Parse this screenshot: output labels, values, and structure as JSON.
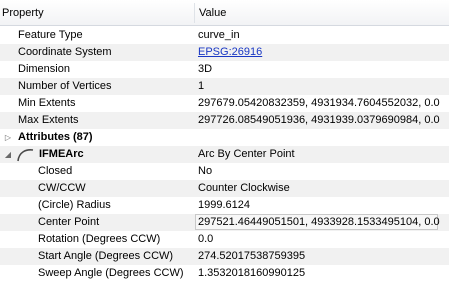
{
  "header": {
    "property_label": "Property",
    "value_label": "Value"
  },
  "rows": [
    {
      "name": "Feature Type",
      "value": "curve_in"
    },
    {
      "name": "Coordinate System",
      "value": "EPSG:26916"
    },
    {
      "name": "Dimension",
      "value": "3D"
    },
    {
      "name": "Number of Vertices",
      "value": "1"
    },
    {
      "name": "Min Extents",
      "value": "297679.05420832359, 4931934.7604552032, 0.0"
    },
    {
      "name": "Max Extents",
      "value": "297726.08549051936, 4931939.0379690984, 0.0"
    }
  ],
  "attributes": {
    "label": "Attributes (87)"
  },
  "arc": {
    "label": "IFMEArc",
    "value": "Arc By Center Point",
    "icon": "arc-icon",
    "children": [
      {
        "name": "Closed",
        "value": "No"
      },
      {
        "name": "CW/CCW",
        "value": "Counter Clockwise"
      },
      {
        "name": "(Circle) Radius",
        "value": "1999.6124"
      },
      {
        "name": "Center Point",
        "value": "297521.46449051501, 4933928.1533495104, 0.0"
      },
      {
        "name": "Rotation (Degrees CCW)",
        "value": "0.0"
      },
      {
        "name": "Start Angle (Degrees CCW)",
        "value": "274.52017538759395"
      },
      {
        "name": "Sweep Angle (Degrees CCW)",
        "value": "1.3532018160990125"
      }
    ]
  },
  "colors": {
    "link": "#1a38c4",
    "alt_row": "#f1f1f1"
  }
}
